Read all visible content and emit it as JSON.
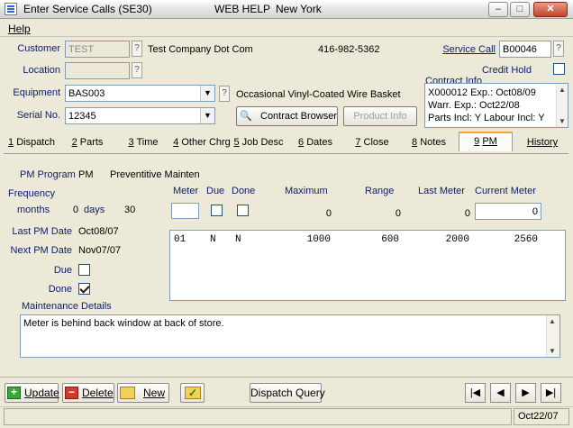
{
  "window": {
    "title": "Enter Service Calls (SE30)",
    "help_label": "WEB HELP",
    "location": "New York",
    "controls": [
      "minimize",
      "maximize",
      "close"
    ]
  },
  "menu": {
    "help": "Help"
  },
  "header": {
    "customer_label": "Customer",
    "customer_value": "TEST",
    "customer_name": "Test Company Dot Com",
    "phone": "416-982-5362",
    "location_label": "Location",
    "location_value": "",
    "equipment_label": "Equipment",
    "equipment_value": "BAS003",
    "equipment_desc": "Occasional Vinyl-Coated Wire Basket",
    "serial_label": "Serial No.",
    "serial_value": "12345",
    "service_call_label": "Service Call",
    "service_call_value": "B00046",
    "credit_hold_label": "Credit Hold",
    "credit_hold_checked": false,
    "question": "?",
    "contract_browser_label": "Contract Browser",
    "product_info_label": "Product Info",
    "contract_info_label": "Contract Info",
    "contract_info_lines": [
      "X000012   Exp.: Oct08/09",
      "Warr. Exp.: Oct22/08",
      "Parts Incl: Y  Labour Incl: Y"
    ]
  },
  "tabs": [
    {
      "num": "1",
      "label": "Dispatch"
    },
    {
      "num": "2",
      "label": "Parts"
    },
    {
      "num": "3",
      "label": "Time"
    },
    {
      "num": "4",
      "label": "Other Chrg"
    },
    {
      "num": "5",
      "label": "Job Desc"
    },
    {
      "num": "6",
      "label": "Dates"
    },
    {
      "num": "7",
      "label": "Close"
    },
    {
      "num": "8",
      "label": "Notes"
    },
    {
      "num": "9",
      "label": "PM"
    },
    {
      "num": "",
      "label": "History"
    }
  ],
  "active_tab": "9 PM",
  "pm": {
    "program_label": "PM Program",
    "program_code": "PM",
    "program_name": "Preventitive Mainten",
    "frequency_label": "Frequency",
    "months_label": "months",
    "months_value": "0",
    "days_label": "days",
    "days_value": "30",
    "meter_label": "Meter",
    "due_label": "Due",
    "done_label": "Done",
    "maximum_label": "Maximum",
    "maximum_value": "0",
    "range_label": "Range",
    "range_value": "0",
    "last_meter_label": "Last Meter",
    "last_meter_value": "0",
    "current_meter_label": "Current Meter",
    "current_meter_value": "0",
    "last_pm_date_label": "Last PM Date",
    "last_pm_date_value": "Oct08/07",
    "next_pm_date_label": "Next PM Date",
    "next_pm_date_value": "Nov07/07",
    "due_check_label": "Due",
    "due_checked": false,
    "done_check_label": "Done",
    "done_checked": true,
    "grid_rows": [
      {
        "meter": "01",
        "due": "N",
        "done": "N",
        "maximum": "1000",
        "range": "600",
        "last_meter": "2000",
        "current_meter": "2560"
      }
    ],
    "maintenance_details_label": "Maintenance Details",
    "maintenance_details_text": "Meter is behind back window at back of store."
  },
  "toolbar": {
    "update": "Update",
    "delete": "Delete",
    "new": "New",
    "dispatch_query": "Dispatch Query"
  },
  "status": {
    "date": "Oct22/07"
  },
  "colors": {
    "label_blue": "#10206a",
    "tab_active_accent": "#f0a43a",
    "window_bg": "#ece9d8"
  }
}
